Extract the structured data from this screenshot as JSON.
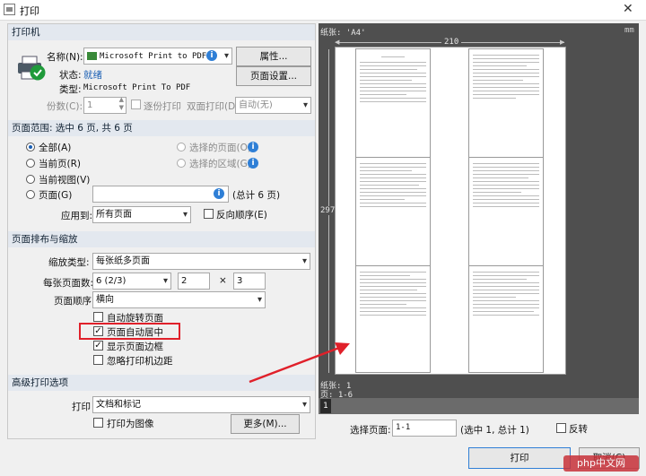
{
  "window": {
    "title": "打印"
  },
  "printer": {
    "section": "打印机",
    "name_label": "名称(N):",
    "name_value": "Microsoft Print to PDF",
    "properties_button": "属性...",
    "status_label": "状态:",
    "status_value": "就绪",
    "type_label": "类型:",
    "type_value": "Microsoft Print To PDF",
    "page_setup_button": "页面设置...",
    "copies_label": "份数(C):",
    "copies_value": "1",
    "collate_label": "逐份打印",
    "duplex_label": "双面打印(D):",
    "duplex_value": "自动(无)"
  },
  "range": {
    "section": "页面范围: 选中 6 页, 共 6 页",
    "all": "全部(A)",
    "current": "当前页(R)",
    "view": "当前视图(V)",
    "pages": "页面(G)",
    "pages_total": "(总计 6 页)",
    "selected_pages": "选择的页面(O)",
    "selected_area": "选择的区域(G)",
    "apply_label": "应用到:",
    "apply_value": "所有页面",
    "reverse": "反向顺序(E)"
  },
  "layout": {
    "section": "页面排布与缩放",
    "scale_label": "缩放类型:",
    "scale_value": "每张纸多页面",
    "per_sheet_label": "每张页面数:",
    "per_sheet_value": "6 (2/3)",
    "cols": "2",
    "times": "×",
    "rows": "3",
    "order_label": "页面顺序:",
    "order_value": "横向",
    "auto_rotate": "自动旋转页面",
    "auto_center": "页面自动居中",
    "show_border": "显示页面边框",
    "ignore_margin": "忽略打印机边距"
  },
  "advanced": {
    "section": "高级打印选项",
    "print_label": "打印",
    "print_value": "文档和标记",
    "as_image": "打印为图像",
    "more_button": "更多(M)..."
  },
  "preview": {
    "paper_label": "纸张: 'A4'",
    "unit": "mm",
    "width": "210",
    "height": "297",
    "sheet_label": "纸张: 1",
    "pages_label": "页: 1-6",
    "page_num": "1",
    "select_label": "选择页面:",
    "select_value": "1-1",
    "select_info": "(选中 1, 总计 1)",
    "reverse": "反转"
  },
  "buttons": {
    "print": "打印",
    "cancel": "取消(C)"
  },
  "watermark": "php中文网",
  "colors": {
    "accent": "#2f7fd6",
    "highlight": "#e0202a",
    "header": "#e3e8ef"
  }
}
